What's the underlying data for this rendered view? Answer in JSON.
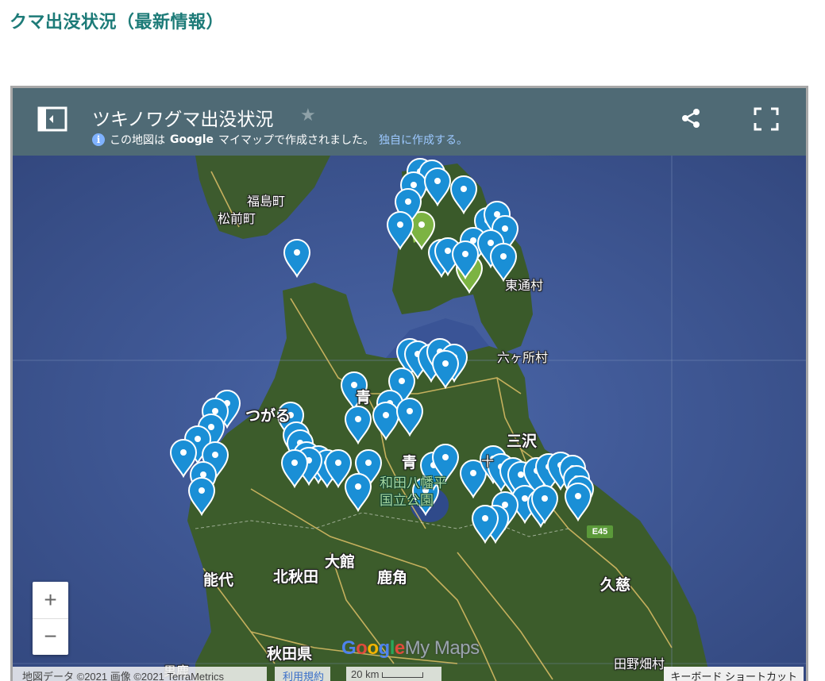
{
  "page": {
    "heading": "クマ出没状況（最新情報）"
  },
  "map_header": {
    "title": "ツキノワグマ出没状況",
    "subtitle_pre": "この地図は",
    "subtitle_brand": "Google",
    "subtitle_post": "マイマップで作成されました。",
    "subtitle_link": "独自に作成する。",
    "info_icon_glyph": "i"
  },
  "place_labels": {
    "fukushima": "福島町",
    "matsumae": "松前町",
    "higashidori": "東通村",
    "rokkasho": "六ヶ所村",
    "tsugaru": "つがる",
    "aomori_city": "青",
    "towada_park_1": "和田八幡平",
    "towada_park_2": "国立公園",
    "misawa": "三沢",
    "aomori_pref": "青",
    "towada": "十",
    "odate": "大館",
    "kitaakita": "北秋田",
    "noshiro": "能代",
    "kazuno": "鹿角",
    "kuji": "久慈",
    "akita_pref": "秋田県",
    "tanohata": "田野畑村",
    "bottom_left": "男鹿"
  },
  "route": {
    "label": "E45"
  },
  "zoom": {
    "in": "+",
    "out": "−"
  },
  "logo": {
    "g": "G",
    "o1": "o",
    "o2": "o",
    "g2": "g",
    "l": "l",
    "e": "e",
    "rest": "My Maps"
  },
  "footer": {
    "attribution": "地図データ ©2021 画像 ©2021 TerraMetrics",
    "terms": "利用規約",
    "scale": "20 km",
    "keyboard": "キーボード ショートカット"
  },
  "colors": {
    "heading": "#1d7b78",
    "header_bg": "#4f6a75",
    "marker_blue": "#1a8fd6",
    "marker_green": "#7cb342",
    "sea": "#3f5a9a",
    "land": "#3a5a2a"
  }
}
